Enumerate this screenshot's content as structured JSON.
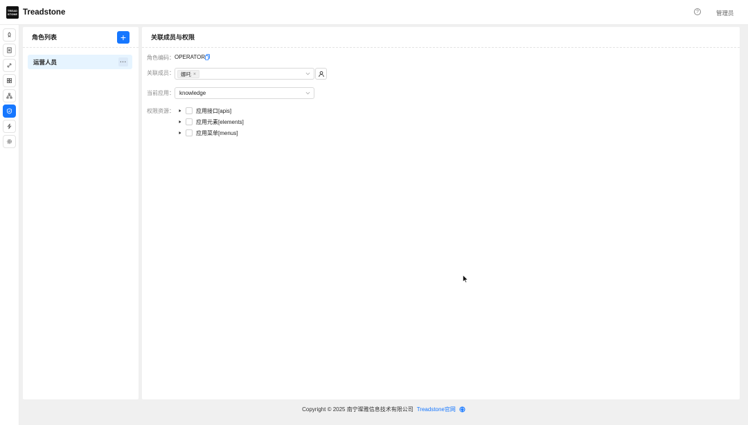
{
  "app": {
    "logo_line1": "TREAD",
    "logo_line2": "STONE",
    "brand": "Treadstone",
    "help_symbol": "?",
    "user_label": "管理员"
  },
  "rail": {
    "items": [
      {
        "icon": "rocket-icon"
      },
      {
        "icon": "document-icon"
      },
      {
        "icon": "link-icon"
      },
      {
        "icon": "grid-icon"
      },
      {
        "icon": "org-tree-icon"
      },
      {
        "icon": "shield-icon",
        "active": true
      },
      {
        "icon": "lightning-icon"
      },
      {
        "icon": "gear-icon"
      }
    ],
    "accent_color": "#1677ff"
  },
  "role_panel": {
    "title": "角色列表",
    "add_symbol": "+",
    "roles": [
      {
        "name": "运营人员",
        "more": "···",
        "selected": true
      }
    ]
  },
  "detail_panel": {
    "title": "关联成员与权限",
    "code_label": "角色编码：",
    "code_value": "OPERATOR",
    "members_label": "关联成员：",
    "members": [
      {
        "name": "娜吒",
        "close": "×"
      }
    ],
    "app_label": "当前应用：",
    "app_value": "knowledge",
    "resources_label": "权限资源：",
    "resources": [
      {
        "label": "应用接口[apis]",
        "checked": false
      },
      {
        "label": "应用元素[elements]",
        "checked": false
      },
      {
        "label": "应用菜单[menus]",
        "checked": false
      }
    ]
  },
  "footer": {
    "copyright": "Copyright © 2025 南宁璨雅信息技术有限公司",
    "link": "Treadstone官网",
    "github_icon": "github-icon"
  }
}
